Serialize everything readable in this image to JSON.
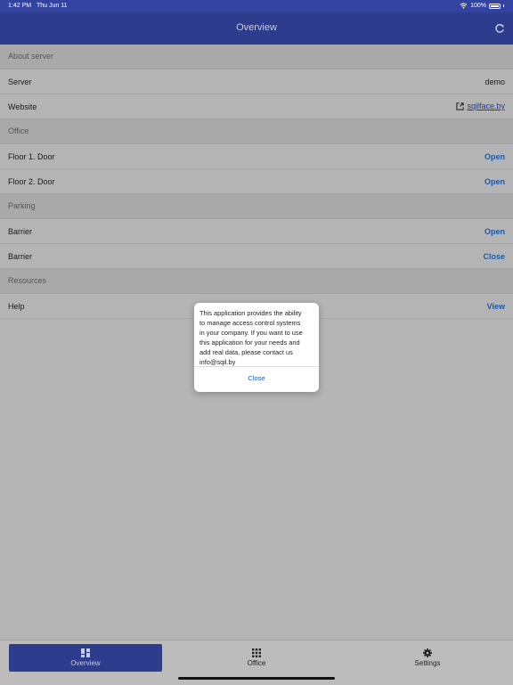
{
  "status_bar": {
    "time": "1:42 PM",
    "date": "Thu Jun 11",
    "battery": "100%"
  },
  "navbar": {
    "title": "Overview"
  },
  "sections": [
    {
      "header": "About server",
      "rows": [
        {
          "label": "Server",
          "value": "demo"
        },
        {
          "label": "Website",
          "link": "sqilface.by"
        }
      ]
    },
    {
      "header": "Office",
      "rows": [
        {
          "label": "Floor 1. Door",
          "action": "Open"
        },
        {
          "label": "Floor 2. Door",
          "action": "Open"
        }
      ]
    },
    {
      "header": "Parking",
      "rows": [
        {
          "label": "Barrier",
          "action": "Open"
        },
        {
          "label": "Barrier",
          "action": "Close"
        }
      ]
    },
    {
      "header": "Resources",
      "rows": [
        {
          "label": "Help",
          "action": "View"
        }
      ]
    }
  ],
  "dialog": {
    "lines": [
      "This application provides the ability",
      "to manage access control systems",
      "in your company. If you want to use",
      "this application for your needs and",
      "add real data, please contact us",
      "info@sqil.by"
    ],
    "button": "Close"
  },
  "tabs": [
    {
      "label": "Overview",
      "icon": "grid-icon",
      "active": true
    },
    {
      "label": "Office",
      "icon": "dots-grid-icon",
      "active": false
    },
    {
      "label": "Settings",
      "icon": "gear-icon",
      "active": false
    }
  ],
  "colors": {
    "navbar": "#2d3c8c",
    "accent": "#1e5aa8",
    "background": "#b4b4b4"
  }
}
